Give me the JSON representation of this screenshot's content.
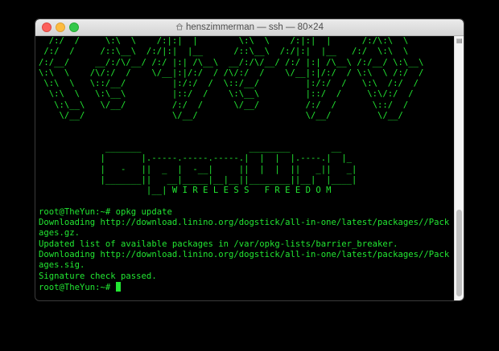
{
  "window": {
    "title": "henszimmerman — ssh — 80×24"
  },
  "terminal": {
    "lines": [
      "  /:/  /     \\:\\  \\    /:|:|  |        \\:\\  \\    /:|:|  |      /:/\\:\\  \\",
      " /:/  /     /::\\__\\  /:/|:|  |__      /::\\__\\  /:/|:|  |__   /:/  \\:\\  \\",
      "/:/__/     __/:/\\/__/ /:/ |:| /\\__\\  __/:/\\/__/ /:/ |:| /\\__\\ /:/__/ \\:\\__\\",
      "\\:\\  \\    /\\/:/  /    \\/__|:|/:/  / /\\/:/  /    \\/__|:|/:/  / \\:\\  \\ /:/  /",
      " \\:\\  \\   \\::/__/         |:/:/  /  \\::/__/         |:/:/  /   \\:\\  /:/  /",
      "  \\:\\  \\   \\:\\__\\         |::/  /    \\:\\__\\         |::/  /     \\:\\/:/  /",
      "   \\:\\__\\   \\/__/         /:/  /      \\/__/         /:/  /       \\::/  /",
      "    \\/__/                 \\/__/                     \\/__/         \\/__/",
      "",
      "",
      "             _______                     ________        __",
      "            |       |.-----.-----.-----.|  |  |  |.----.|  |_",
      "            |   -   ||  _  |  -__|     ||  |  |  ||   _||   _|",
      "            |_______||   __|_____|__|__||________||__|  |____|",
      "                     |__| W I R E L E S S   F R E E D O M",
      "",
      "root@TheYun:~# opkg update",
      "Downloading http://download.linino.org/dogstick/all-in-one/latest/packages//Pack",
      "ages.gz.",
      "Updated list of available packages in /var/opkg-lists/barrier_breaker.",
      "Downloading http://download.linino.org/dogstick/all-in-one/latest/packages//Pack",
      "ages.sig.",
      "Signature check passed."
    ],
    "prompt": "root@TheYun:~# "
  },
  "colors": {
    "terminal_text": "#22e632",
    "terminal_bg": "#000000",
    "titlebar": "#dcdcdc"
  }
}
